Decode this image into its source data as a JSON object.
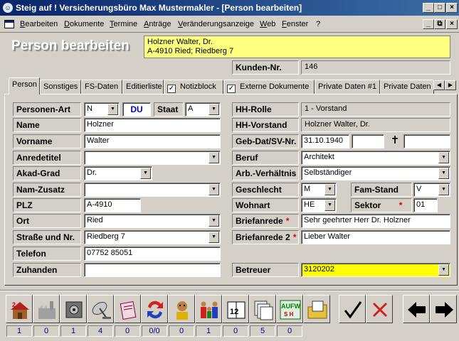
{
  "window": {
    "title": "Steig auf ! Versicherungsbüro Max Mustermakler - [Person bearbeiten]",
    "buttons": {
      "minimize": "_",
      "maximize": "□",
      "close": "×",
      "restore": "⧉"
    }
  },
  "menu": [
    "Bearbeiten",
    "Dokumente",
    "Termine",
    "Anträge",
    "Veränderungsanzeige",
    "Web",
    "Fenster",
    "?"
  ],
  "header": {
    "title": "Person bearbeiten",
    "person_line1": "Holzner Walter, Dr.",
    "person_line2": "A-4910 Ried; Riedberg 7",
    "kunden_label": "Kunden-Nr.",
    "kunden_value": "146"
  },
  "tabs": [
    {
      "label": "Person",
      "active": true
    },
    {
      "label": "Sonstiges"
    },
    {
      "label": "FS-Daten"
    },
    {
      "label": "Editierliste"
    },
    {
      "label": "Notizblock",
      "checked": true
    },
    {
      "label": "Externe Dokumente",
      "checked": true
    },
    {
      "label": "Private Daten #1"
    },
    {
      "label": "Private Daten"
    }
  ],
  "tab_scroll": {
    "left": "◀",
    "right": "▶"
  },
  "check_mark": "✓",
  "dropdown_arrow": "▼",
  "required_mark": "*",
  "left_form": {
    "personen_art": {
      "label": "Personen-Art",
      "value": "N",
      "du": "DU",
      "staat_label": "Staat",
      "staat_value": "A"
    },
    "name": {
      "label": "Name",
      "value": "Holzner"
    },
    "vorname": {
      "label": "Vorname",
      "value": "Walter"
    },
    "anredetitel": {
      "label": "Anredetitel",
      "value": ""
    },
    "akad_grad": {
      "label": "Akad-Grad",
      "value": "Dr."
    },
    "nam_zusatz": {
      "label": "Nam-Zusatz",
      "value": ""
    },
    "plz": {
      "label": "PLZ",
      "value": "A-4910"
    },
    "ort": {
      "label": "Ort",
      "value": "Ried"
    },
    "strasse": {
      "label": "Straße und Nr.",
      "value": "Riedberg 7"
    },
    "telefon": {
      "label": "Telefon",
      "value": "07752 85051"
    },
    "zuhanden": {
      "label": "Zuhanden",
      "value": ""
    }
  },
  "right_form": {
    "hh_rolle": {
      "label": "HH-Rolle",
      "value": "1 - Vorstand"
    },
    "hh_vorstand": {
      "label": "HH-Vorstand",
      "value": "Holzner Walter, Dr."
    },
    "geb_dat": {
      "label": "Geb-Dat/SV-Nr.",
      "value": "31.10.1940",
      "sv_nr": "",
      "cross": "✝",
      "death": ""
    },
    "beruf": {
      "label": "Beruf",
      "value": "Architekt"
    },
    "arb_verhaeltnis": {
      "label": "Arb.-Verhältnis",
      "value": "Selbständiger"
    },
    "geschlecht": {
      "label": "Geschlecht",
      "value": "M",
      "fam_stand_label": "Fam-Stand",
      "fam_stand_value": "V"
    },
    "wohnart": {
      "label": "Wohnart",
      "value": "HE",
      "sektor_label": "Sektor",
      "sektor_value": "01"
    },
    "briefanrede": {
      "label": "Briefanrede",
      "value": "Sehr geehrter Herr Dr. Holzner"
    },
    "briefanrede2": {
      "label": "Briefanrede 2",
      "value": "Lieber Walter"
    },
    "betreuer": {
      "label": "Betreuer",
      "value": "3120202",
      "highlight": "#ffff00"
    }
  },
  "toolbar": {
    "buttons": [
      "house-icon",
      "factory-icon",
      "safe-icon",
      "satellite-icon",
      "document-icon",
      "transfer-icon",
      "person-icon",
      "family-icon",
      "calendar-icon",
      "documents-icon",
      "aufw-icon",
      "folder-icon"
    ],
    "counters": [
      "1",
      "0",
      "1",
      "4",
      "0",
      "0/0",
      "0",
      "1",
      "0",
      "5",
      "0"
    ],
    "aufw_text": "AUFW",
    "aufw_sub": "S H",
    "calendar_text": "12",
    "house_badge": "2"
  },
  "colors": {
    "titlebar": "#0a246a",
    "highlight": "#ffff80",
    "required": "#e00000",
    "face": "#d4d0c8"
  }
}
